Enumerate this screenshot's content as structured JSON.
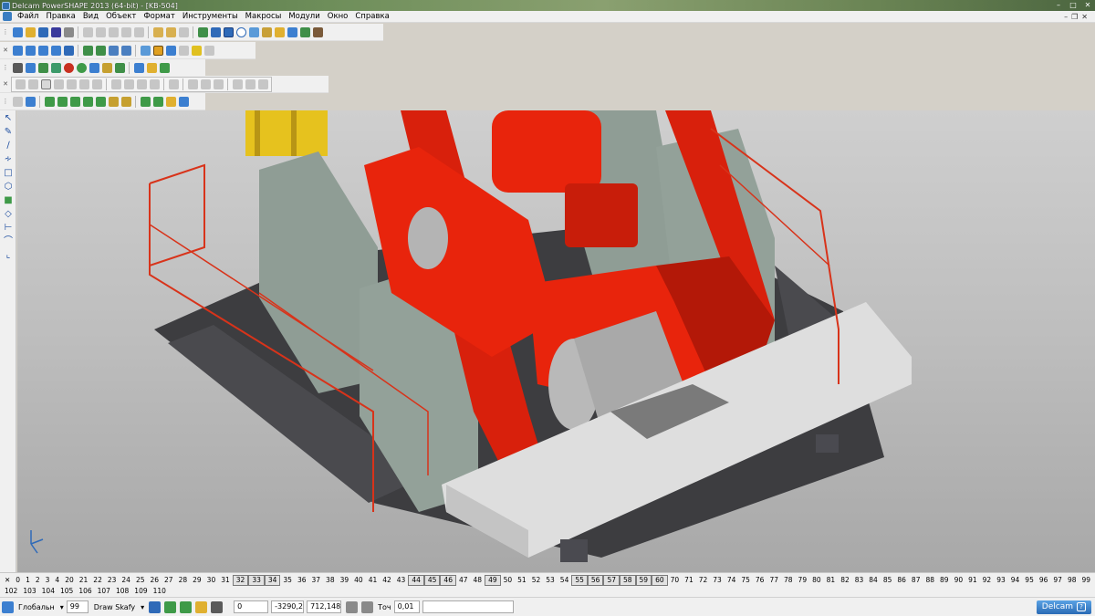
{
  "window": {
    "title": "Delcam PowerSHAPE 2013 (64-bit) - [KB-504]"
  },
  "menu": [
    "Файл",
    "Правка",
    "Вид",
    "Объект",
    "Формат",
    "Инструменты",
    "Макросы",
    "Модули",
    "Окно",
    "Справка"
  ],
  "status": {
    "workplane": "Глобальн",
    "level_number": "99",
    "level_name": "Draw Skafy",
    "coord_x": "0",
    "coord_y": "-3290,2",
    "coord_z": "712,148",
    "tolerance_label": "Точ",
    "tolerance": "0,01",
    "brand": "Delcam"
  },
  "levels": {
    "row1": [
      "0",
      "1",
      "2",
      "3",
      "4",
      "20",
      "21",
      "22",
      "23",
      "24",
      "25",
      "26",
      "27",
      "28",
      "29",
      "30",
      "31",
      "32",
      "33",
      "34",
      "35",
      "36",
      "37",
      "38",
      "39",
      "40",
      "41",
      "42",
      "43",
      "44",
      "45",
      "46",
      "47",
      "48",
      "49",
      "50",
      "51",
      "52",
      "53",
      "54",
      "55",
      "56",
      "57",
      "58",
      "59",
      "60",
      "70",
      "71",
      "72",
      "73",
      "74",
      "75",
      "76",
      "77",
      "78",
      "79",
      "80",
      "81",
      "82",
      "83",
      "84",
      "85",
      "86",
      "87",
      "88",
      "89",
      "90",
      "91",
      "92",
      "93",
      "94",
      "95",
      "96",
      "97",
      "98",
      "99",
      "101"
    ],
    "row1_boxed": [
      "32",
      "33",
      "34",
      "44",
      "45",
      "46",
      "49",
      "55",
      "56",
      "57",
      "58",
      "59",
      "60"
    ],
    "row2": [
      "102",
      "103",
      "104",
      "105",
      "106",
      "107",
      "108",
      "109",
      "110"
    ]
  },
  "colors": {
    "machine_red": "#e8240c",
    "cabinet_gray": "#8f9d95",
    "platform_dark": "#3d3d40",
    "railing": "#d8331a",
    "deck_light": "#dedede",
    "drum_steel": "#a9a9a9",
    "yellow_frame": "#e6c21e"
  },
  "icons": {
    "left_palette": [
      "select-arrow-icon",
      "edit-icon",
      "line-icon",
      "polyline-icon",
      "rectangle-icon",
      "polygon-icon",
      "solid-box-icon",
      "surface-icon",
      "dimension-icon",
      "arc-icon",
      "curve-icon"
    ]
  }
}
